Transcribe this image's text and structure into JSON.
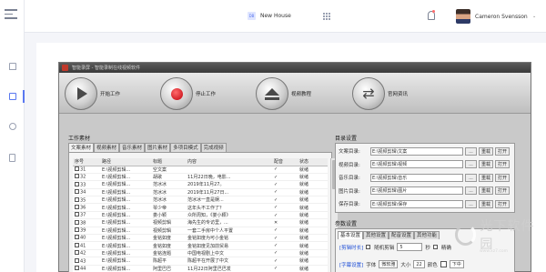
{
  "header": {
    "brand_badge": "DB",
    "brand_title": "New House",
    "user_name": "Cameron Svensson",
    "user_caret": "⌄"
  },
  "sidebar": {
    "items": [
      {
        "icon": "home-icon",
        "active": false
      },
      {
        "icon": "folder-icon",
        "active": true
      },
      {
        "icon": "link-icon",
        "active": false
      },
      {
        "icon": "file-icon",
        "active": false
      }
    ]
  },
  "app_window": {
    "title": "智能录屏 - 智能录制在线视频软件",
    "toolbar": [
      {
        "label": "开始工作",
        "icon": "play-icon"
      },
      {
        "label": "停止工作",
        "icon": "record-icon"
      },
      {
        "label": "视频教程",
        "icon": "eject-icon"
      },
      {
        "label": "官网资讯",
        "icon": "refresh-icon"
      }
    ],
    "work_group_label": "工作素材",
    "tabs": [
      "文案素材",
      "视频素材",
      "音乐素材",
      "图片素材",
      "多项目模式",
      "完成视频"
    ],
    "table": {
      "columns": [
        "序号",
        "路径",
        "标题",
        "内容",
        "配音",
        "状态"
      ],
      "rows": [
        [
          "31",
          "E:\\视频剪辑...",
          "空文案",
          "",
          "✓",
          "就绪"
        ],
        [
          "32",
          "E:\\视频剪辑...",
          "胡歌",
          "11月22日晚，电影...",
          "✓",
          "就绪"
        ],
        [
          "33",
          "E:\\视频剪辑...",
          "范冰冰",
          "2019年11月27。",
          "✓",
          "就绪"
        ],
        [
          "34",
          "E:\\视频剪辑...",
          "范冰冰",
          "2019年11月27日...",
          "✓",
          "就绪"
        ],
        [
          "35",
          "E:\\视频剪辑...",
          "范冰冰",
          "范冰冰一直是娱...",
          "✓",
          "就绪"
        ],
        [
          "36",
          "E:\\视频剪辑...",
          "琴少帝",
          "这年头不工作了？",
          "✓",
          "就绪"
        ],
        [
          "37",
          "E:\\视频剪辑...",
          "娄小颖",
          "众所周知，《娄小颖》",
          "✓",
          "就绪"
        ],
        [
          "38",
          "E:\\视频剪辑...",
          "视频剪辑",
          "海先生的专访里，...",
          "✕",
          "就绪"
        ],
        [
          "39",
          "E:\\视频剪辑...",
          "视频剪辑",
          "一套二手房中个人平置",
          "✓",
          "就绪"
        ],
        [
          "40",
          "E:\\视频剪辑...",
          "金铭如度",
          "金铭如度为可小金铭",
          "✓",
          "就绪"
        ],
        [
          "41",
          "E:\\视频剪辑...",
          "金铭如度",
          "金铭如度见加前贸易",
          "✓",
          "就绪"
        ],
        [
          "42",
          "E:\\视频剪辑...",
          "金铭连题",
          "中国电视剧上中文",
          "✓",
          "就绪"
        ],
        [
          "43",
          "E:\\视频剪辑...",
          "陈超平",
          "陈超平在开展了中文",
          "✓",
          "就绪"
        ],
        [
          "44",
          "E:\\视频剪辑...",
          "阿里巴巴",
          "11月22日阿里巴巴发",
          "✓",
          "就绪"
        ]
      ]
    },
    "dir_group_label": "目录设置",
    "dirs": [
      {
        "label": "文案目录:",
        "path": "E:\\视频剪辑\\文案"
      },
      {
        "label": "视频目录:",
        "path": "E:\\视频剪辑\\视频"
      },
      {
        "label": "音乐目录:",
        "path": "E:\\视频剪辑\\音乐"
      },
      {
        "label": "图片目录:",
        "path": "E:\\视频剪辑\\图片"
      },
      {
        "label": "保存目录:",
        "path": "E:\\视频剪辑\\保存"
      }
    ],
    "dir_buttons": {
      "browse": "...",
      "reload": "重载",
      "open": "打开"
    },
    "param_group_label": "参数设置",
    "param_tabs": [
      "基本设置",
      "其他设置",
      "配音设置",
      "其他功能"
    ],
    "params": {
      "clip_label": "[剪辑时长]",
      "random_clip": "随机剪辑",
      "clip_value": "5",
      "seconds_unit": "秒",
      "precise": "精确",
      "subtitle_label": "[字幕设置]",
      "font_label": "字体",
      "font_value": "微软雅",
      "size_label": "大小",
      "size_value": "22",
      "color_label": "颜色",
      "position_value": "下中"
    }
  },
  "watermark": {
    "text": "光下软件园",
    "sub": "www.xz7.com"
  }
}
